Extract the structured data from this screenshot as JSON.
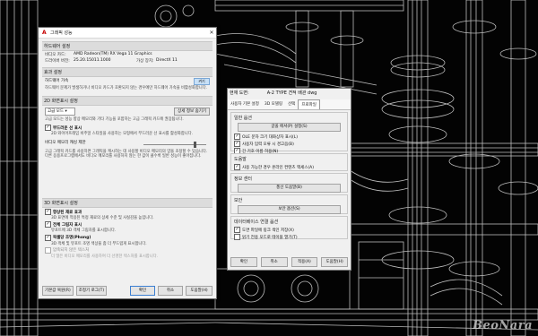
{
  "main_dialog": {
    "title": "그래픽 성능",
    "hardware_section": "하드웨어 설정",
    "video_card_label": "비디오 카드:",
    "video_card_value": "AMD Radeon(TM) RX Vega 11 Graphics",
    "driver_label": "드라이버 버전:",
    "driver_value": "25.20.15011.1000",
    "virtual_label": "가상 장치:",
    "virtual_value": "DirectX 11",
    "effects_section": "효과 설정",
    "hw_accel_label": "하드웨어 가속",
    "hw_accel_desc": "하드웨어 문제가 발생하거나 비디오 카드가 호환되지 않는 경우에만 하드웨어 가속을 비활성화합니다.",
    "hw_accel_state": "켜기",
    "d2_section": "2D 화면표시 설정",
    "d2_mode": "고급 모드",
    "d2_mode_btn": "상세 정보 숨기기",
    "d2_desc": "고급 모드는 성능 향상 메모리와 기타 기능을 포함하는 고급 그래픽 카드에 권장됩니다.",
    "smooth_label": "부드러운 선 표시",
    "smooth_desc": "2D 와이어프레임 비주얼 스타일을 사용하는 모형에서 부드러운 선 표시를 활성화합니다.",
    "smooth_on": true,
    "vram_label": "비디오 메모리 캐싱 제한",
    "vram_desc": "고급 그래픽 카드를 사용하면 그래픽을 캐시하는 데 사용할 비디오 메모리의 양을 조정할 수 있습니다. 다른 응용프로그램에서도 비디오 메모리를 사용하지 않는 한 값이 클수록 일반 성능이 좋아집니다.",
    "vram_level": 0.8,
    "d3_section": "3D 화면표시 설정",
    "d3_item1_label": "향상된 재료 효과",
    "d3_item1_desc": "3D 표면에 적용된 특정 재료의 상세 수준 및 사실감을 높입니다.",
    "d3_item1_on": true,
    "d3_item2_label": "전체 그림자 표시",
    "d3_item2_desc": "뷰포트에 3D 객체 그림자를 표시합니다.",
    "d3_item2_on": true,
    "d3_item3_label": "픽셀당 조명(Phong)",
    "d3_item3_desc": "3D 객체 및 뷰포트 조명 색상을 좀 더 부드럽게 표시합니다.",
    "d3_item3_on": true,
    "d3_item4_label": "압축되지 않은 텍스처",
    "d3_item4_desc": "더 많은 비디오 메모리를 사용하여 더 선명한 텍스처를 표시합니다.",
    "d3_item4_on": false,
    "reset_btn": "기본값 복원(R)",
    "tune_btn": "조정기 로그(T)",
    "ok_btn": "확인",
    "cancel_btn": "취소",
    "help_btn": "도움말(H)"
  },
  "back_dialog": {
    "profile_label": "현재 도면:",
    "profile_value": "A-2 TYPE 견적 배관 dwg",
    "tabs": [
      "사용자 기본 설정",
      "3D 모델링",
      "선택",
      "프로파일"
    ],
    "sec1_title": "일반 옵션",
    "sec1_btn": "글꼴 에서(P) 설정(S)",
    "sec1_checks": [
      {
        "label": "OLE 문자 크기 대화상자 표시(L)",
        "on": true
      },
      {
        "label": "사용자 입력 오류 시 경고음(B)",
        "on": true
      },
      {
        "label": "긴 기호 이름 허용(N)",
        "on": true
      }
    ],
    "sec2_title": "도움말",
    "sec2_check": {
      "label": "사용 가능한 경우 온라인 컨텐츠 액세스(A)",
      "on": true
    },
    "sec3_title": "정보 센터",
    "sec3_btn": "풍선 도움말(B)",
    "sec4_title": "보안",
    "sec4_btn": "보안 옵션(S)",
    "sec5_title": "데이터베이스 연결 옵션",
    "sec5_checks": [
      {
        "label": "도면 파일에 링크 색인 저장(X)",
        "on": true
      },
      {
        "label": "읽기 전용 모드로 테이블 열기(T)",
        "on": false
      }
    ],
    "ok_btn": "확인",
    "cancel_btn": "취소",
    "apply_btn": "적용(A)",
    "help_btn": "도움말(H)"
  },
  "watermark": "BeoNara"
}
